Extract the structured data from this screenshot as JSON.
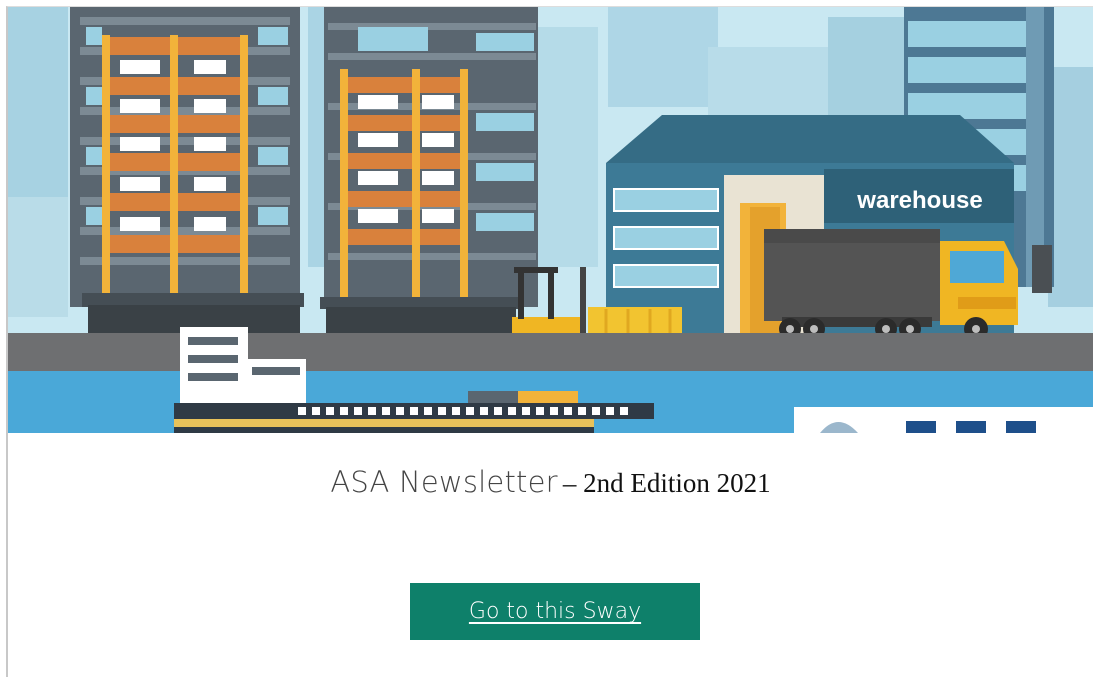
{
  "hero": {
    "warehouse_sign": "warehouse",
    "colors": {
      "sky": "#c9e8f2",
      "building_gray": "#5a6670",
      "scaffold_orange": "#d9813c",
      "scaffold_yellow": "#f2b33a",
      "warehouse_blue": "#3d7a96",
      "water_blue": "#4aa8d8",
      "truck_gray": "#545454",
      "cab_yellow": "#f0b623"
    }
  },
  "newsletter": {
    "title": "ASA Newsletter",
    "subtitle": "– 2nd Edition 2021"
  },
  "cta": {
    "label": "Go to this Sway",
    "color": "#0e806a"
  }
}
